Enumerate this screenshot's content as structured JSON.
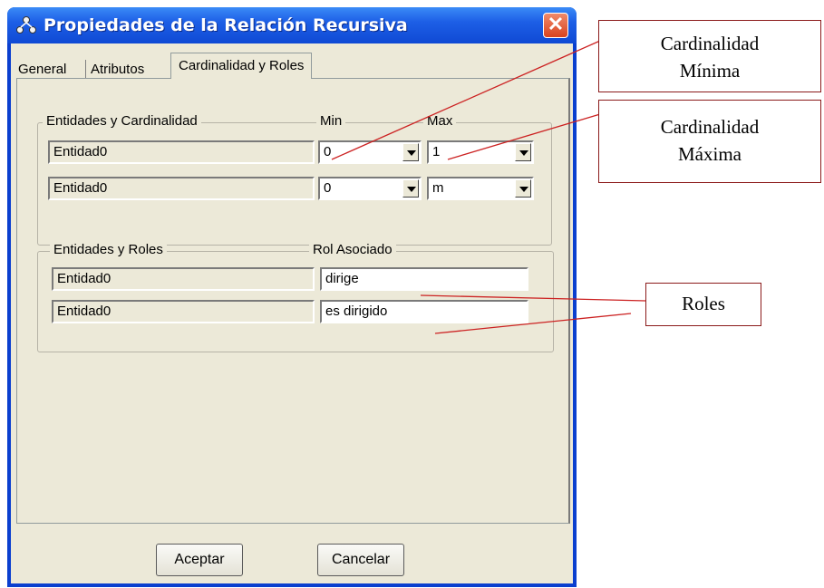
{
  "window": {
    "title": "Propiedades de la Relación Recursiva",
    "close_symbol": "✕"
  },
  "tabs": [
    {
      "label": "General"
    },
    {
      "label": "Atributos"
    },
    {
      "label": "Cardinalidad y Roles",
      "active": true
    }
  ],
  "cardinality_group": {
    "legend": "Entidades y Cardinalidad",
    "min_header": "Min",
    "max_header": "Max",
    "rows": [
      {
        "entity": "Entidad0",
        "min": "0",
        "max": "1"
      },
      {
        "entity": "Entidad0",
        "min": "0",
        "max": "m"
      }
    ]
  },
  "roles_group": {
    "legend": "Entidades y Roles",
    "role_header": "Rol Asociado",
    "rows": [
      {
        "entity": "Entidad0",
        "role": "dirige"
      },
      {
        "entity": "Entidad0",
        "role": "es dirigido"
      }
    ]
  },
  "buttons": {
    "accept": "Aceptar",
    "cancel": "Cancelar"
  },
  "annotations": {
    "min_line1": "Cardinalidad",
    "min_line2": "Mínima",
    "max_line1": "Cardinalidad",
    "max_line2": "Máxima",
    "roles": "Roles"
  },
  "colors": {
    "titlebar": "#1d5fe6",
    "callout_border": "#8b1a1a",
    "connector": "#cc2222"
  }
}
